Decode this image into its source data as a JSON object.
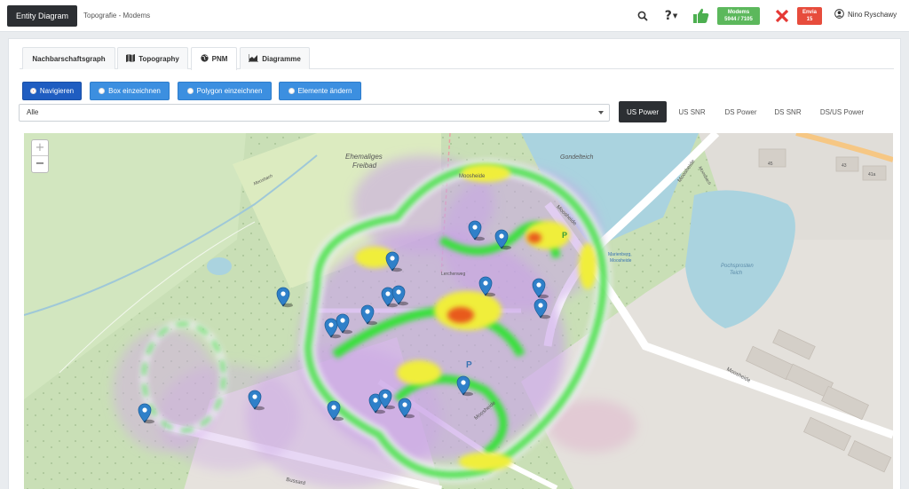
{
  "topbar": {
    "brand_label": "Entity Diagram",
    "breadcrumb": "Topografie - Modems",
    "help_label": "?",
    "badge_green": {
      "line1": "Modems",
      "line2": "5944 / 7105"
    },
    "badge_red": {
      "line1": "Envia",
      "line2": "15"
    },
    "user_name": "Nino Ryschawy",
    "icons": [
      "search-icon",
      "help-icon",
      "thumbs-up-icon",
      "close-icon",
      "user-icon"
    ]
  },
  "tabs": [
    {
      "label": "Nachbarschaftsgraph",
      "icon": ""
    },
    {
      "label": "Topography",
      "icon": "map-icon"
    },
    {
      "label": "PNM",
      "icon": "globe-icon"
    },
    {
      "label": "Diagramme",
      "icon": "area-chart-icon"
    }
  ],
  "active_tab": "PNM",
  "modes": [
    {
      "label": "Navigieren",
      "selected": true
    },
    {
      "label": "Box einzeichnen",
      "selected": false
    },
    {
      "label": "Polygon einzeichnen",
      "selected": false
    },
    {
      "label": "Elemente ändern",
      "selected": false
    }
  ],
  "filter": {
    "value": "Alle"
  },
  "metrics": [
    "US Power",
    "US SNR",
    "DS Power",
    "DS SNR",
    "DS/US Power"
  ],
  "active_metric": "US Power",
  "map": {
    "zoom_in": "+",
    "zoom_out": "−",
    "labels": {
      "freibad_1": "Ehemaliges",
      "freibad_2": "Freibad",
      "gondelteich": "Gondelteich",
      "moosbach": "Moosbach",
      "moosbach2": "Moosbach",
      "moosheide_top": "Moosheide",
      "moosheide_road": "Moosheide",
      "moosheide_right": "Moosheide",
      "moosheide_lower": "Moosheide",
      "marienberg_1": "Marienberg,",
      "marienberg_2": "Moosheide",
      "teich_1": "Pochsprosten",
      "teich_2": "Teich",
      "bussard": "Bussard",
      "lerchenweg": "Lerchenweg",
      "p1": "P",
      "p2": "P",
      "n45": "45",
      "n43": "43",
      "n41a": "41a"
    }
  }
}
